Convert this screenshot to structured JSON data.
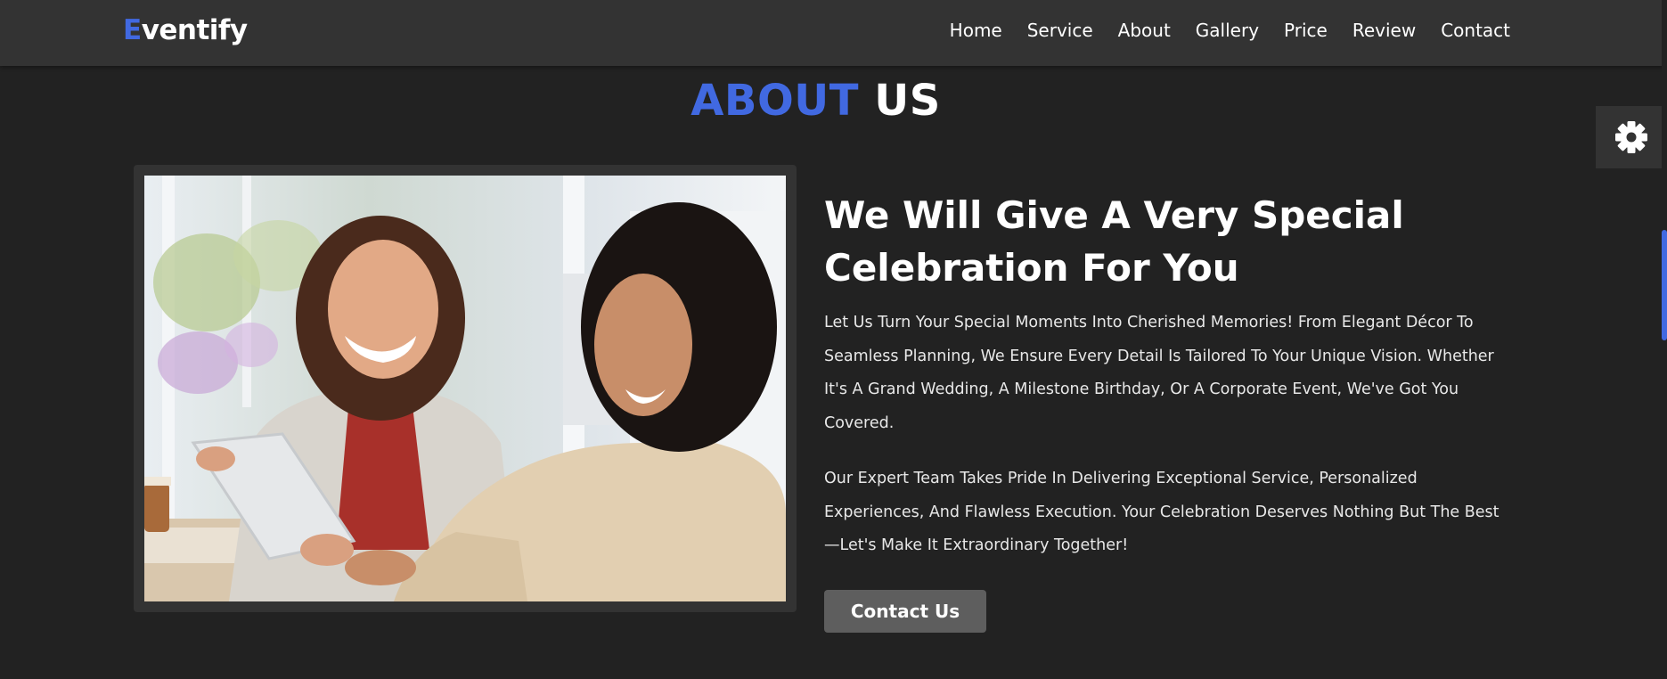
{
  "brand": {
    "first_letter": "E",
    "rest": "ventify"
  },
  "nav": {
    "items": [
      {
        "label": "Home"
      },
      {
        "label": "Service"
      },
      {
        "label": "About"
      },
      {
        "label": "Gallery"
      },
      {
        "label": "Price"
      },
      {
        "label": "Review"
      },
      {
        "label": "Contact"
      }
    ]
  },
  "about": {
    "title_accent": "ABOUT",
    "title_rest": "US",
    "headline": "We Will Give A Very Special Celebration For You",
    "paragraph1": "Let Us Turn Your Special Moments Into Cherished Memories! From Elegant Décor To Seamless Planning, We Ensure Every Detail Is Tailored To Your Unique Vision. Whether It's A Grand Wedding, A Milestone Birthday, Or A Corporate Event, We've Got You Covered.",
    "paragraph2": "Our Expert Team Takes Pride In Delivering Exceptional Service, Personalized Experiences, And Flawless Execution. Your Celebration Deserves Nothing But The Best—Let's Make It Extraordinary Together!",
    "button_label": "Contact Us"
  },
  "icons": {
    "settings": "gear-icon"
  },
  "colors": {
    "accent": "#4169e1",
    "background": "#222222",
    "navbar": "#333333",
    "button": "#5e5e5e"
  }
}
